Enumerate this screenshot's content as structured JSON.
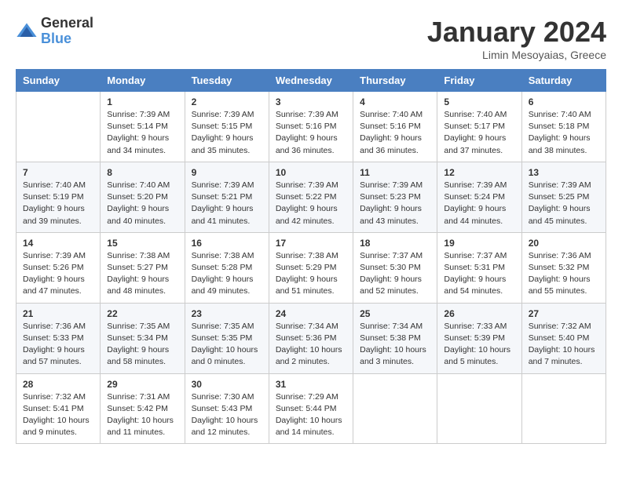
{
  "header": {
    "logo_general": "General",
    "logo_blue": "Blue",
    "month": "January 2024",
    "location": "Limin Mesoyaias, Greece"
  },
  "weekdays": [
    "Sunday",
    "Monday",
    "Tuesday",
    "Wednesday",
    "Thursday",
    "Friday",
    "Saturday"
  ],
  "weeks": [
    [
      {
        "day": "",
        "info": ""
      },
      {
        "day": "1",
        "info": "Sunrise: 7:39 AM\nSunset: 5:14 PM\nDaylight: 9 hours\nand 34 minutes."
      },
      {
        "day": "2",
        "info": "Sunrise: 7:39 AM\nSunset: 5:15 PM\nDaylight: 9 hours\nand 35 minutes."
      },
      {
        "day": "3",
        "info": "Sunrise: 7:39 AM\nSunset: 5:16 PM\nDaylight: 9 hours\nand 36 minutes."
      },
      {
        "day": "4",
        "info": "Sunrise: 7:40 AM\nSunset: 5:16 PM\nDaylight: 9 hours\nand 36 minutes."
      },
      {
        "day": "5",
        "info": "Sunrise: 7:40 AM\nSunset: 5:17 PM\nDaylight: 9 hours\nand 37 minutes."
      },
      {
        "day": "6",
        "info": "Sunrise: 7:40 AM\nSunset: 5:18 PM\nDaylight: 9 hours\nand 38 minutes."
      }
    ],
    [
      {
        "day": "7",
        "info": "Sunrise: 7:40 AM\nSunset: 5:19 PM\nDaylight: 9 hours\nand 39 minutes."
      },
      {
        "day": "8",
        "info": "Sunrise: 7:40 AM\nSunset: 5:20 PM\nDaylight: 9 hours\nand 40 minutes."
      },
      {
        "day": "9",
        "info": "Sunrise: 7:39 AM\nSunset: 5:21 PM\nDaylight: 9 hours\nand 41 minutes."
      },
      {
        "day": "10",
        "info": "Sunrise: 7:39 AM\nSunset: 5:22 PM\nDaylight: 9 hours\nand 42 minutes."
      },
      {
        "day": "11",
        "info": "Sunrise: 7:39 AM\nSunset: 5:23 PM\nDaylight: 9 hours\nand 43 minutes."
      },
      {
        "day": "12",
        "info": "Sunrise: 7:39 AM\nSunset: 5:24 PM\nDaylight: 9 hours\nand 44 minutes."
      },
      {
        "day": "13",
        "info": "Sunrise: 7:39 AM\nSunset: 5:25 PM\nDaylight: 9 hours\nand 45 minutes."
      }
    ],
    [
      {
        "day": "14",
        "info": "Sunrise: 7:39 AM\nSunset: 5:26 PM\nDaylight: 9 hours\nand 47 minutes."
      },
      {
        "day": "15",
        "info": "Sunrise: 7:38 AM\nSunset: 5:27 PM\nDaylight: 9 hours\nand 48 minutes."
      },
      {
        "day": "16",
        "info": "Sunrise: 7:38 AM\nSunset: 5:28 PM\nDaylight: 9 hours\nand 49 minutes."
      },
      {
        "day": "17",
        "info": "Sunrise: 7:38 AM\nSunset: 5:29 PM\nDaylight: 9 hours\nand 51 minutes."
      },
      {
        "day": "18",
        "info": "Sunrise: 7:37 AM\nSunset: 5:30 PM\nDaylight: 9 hours\nand 52 minutes."
      },
      {
        "day": "19",
        "info": "Sunrise: 7:37 AM\nSunset: 5:31 PM\nDaylight: 9 hours\nand 54 minutes."
      },
      {
        "day": "20",
        "info": "Sunrise: 7:36 AM\nSunset: 5:32 PM\nDaylight: 9 hours\nand 55 minutes."
      }
    ],
    [
      {
        "day": "21",
        "info": "Sunrise: 7:36 AM\nSunset: 5:33 PM\nDaylight: 9 hours\nand 57 minutes."
      },
      {
        "day": "22",
        "info": "Sunrise: 7:35 AM\nSunset: 5:34 PM\nDaylight: 9 hours\nand 58 minutes."
      },
      {
        "day": "23",
        "info": "Sunrise: 7:35 AM\nSunset: 5:35 PM\nDaylight: 10 hours\nand 0 minutes."
      },
      {
        "day": "24",
        "info": "Sunrise: 7:34 AM\nSunset: 5:36 PM\nDaylight: 10 hours\nand 2 minutes."
      },
      {
        "day": "25",
        "info": "Sunrise: 7:34 AM\nSunset: 5:38 PM\nDaylight: 10 hours\nand 3 minutes."
      },
      {
        "day": "26",
        "info": "Sunrise: 7:33 AM\nSunset: 5:39 PM\nDaylight: 10 hours\nand 5 minutes."
      },
      {
        "day": "27",
        "info": "Sunrise: 7:32 AM\nSunset: 5:40 PM\nDaylight: 10 hours\nand 7 minutes."
      }
    ],
    [
      {
        "day": "28",
        "info": "Sunrise: 7:32 AM\nSunset: 5:41 PM\nDaylight: 10 hours\nand 9 minutes."
      },
      {
        "day": "29",
        "info": "Sunrise: 7:31 AM\nSunset: 5:42 PM\nDaylight: 10 hours\nand 11 minutes."
      },
      {
        "day": "30",
        "info": "Sunrise: 7:30 AM\nSunset: 5:43 PM\nDaylight: 10 hours\nand 12 minutes."
      },
      {
        "day": "31",
        "info": "Sunrise: 7:29 AM\nSunset: 5:44 PM\nDaylight: 10 hours\nand 14 minutes."
      },
      {
        "day": "",
        "info": ""
      },
      {
        "day": "",
        "info": ""
      },
      {
        "day": "",
        "info": ""
      }
    ]
  ]
}
